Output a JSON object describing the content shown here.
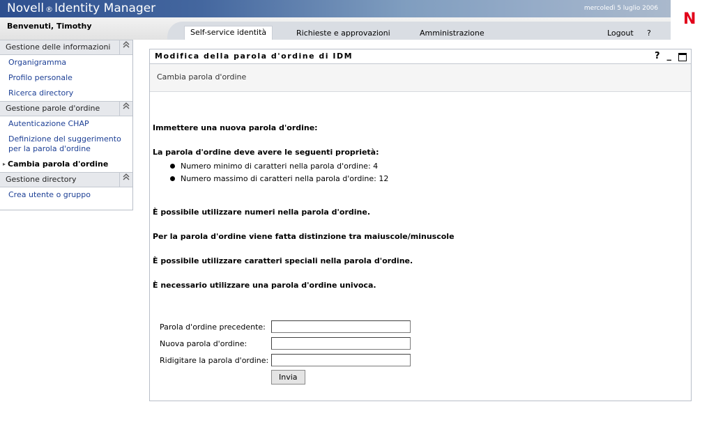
{
  "header": {
    "brand_name": "Novell",
    "brand_reg": "®",
    "brand_product": "Identity Manager",
    "date": "mercoledì 5 luglio 2006",
    "user": "Benvenuti, Timothy",
    "logo_letter": "N"
  },
  "tabs": [
    {
      "label": "Self-service identità",
      "active": true
    },
    {
      "label": "Richieste e approvazioni",
      "active": false
    },
    {
      "label": "Amministrazione",
      "active": false
    },
    {
      "label": "Logout",
      "active": false
    },
    {
      "label": "?",
      "active": false
    }
  ],
  "sidebar": {
    "sections": [
      {
        "title": "Gestione delle informazioni",
        "items": [
          "Organigramma",
          "Profilo personale",
          "Ricerca directory"
        ]
      },
      {
        "title": "Gestione parole d'ordine",
        "items": [
          "Autenticazione CHAP",
          "Definizione del suggerimento per la parola d'ordine",
          "Cambia parola d'ordine"
        ]
      },
      {
        "title": "Gestione directory",
        "items": [
          "Crea utente o gruppo"
        ]
      }
    ],
    "collapse_glyph": "⌃"
  },
  "panel": {
    "title": "Modifica della parola d'ordine di IDM",
    "help": "?",
    "minimize": "_",
    "subtitle": "Cambia parola d'ordine"
  },
  "content": {
    "prompt": "Immettere una nuova parola d'ordine:",
    "rules_heading": "La parola d'ordine deve avere le seguenti proprietà:",
    "rules": [
      "Numero minimo di caratteri nella parola d'ordine: 4",
      "Numero massimo di caratteri nella parola d'ordine: 12"
    ],
    "note_numbers": "È possibile utilizzare numeri nella parola d'ordine.",
    "note_case": "Per la parola d'ordine viene fatta distinzione tra maiuscole/minuscole",
    "note_special": "È possibile utilizzare caratteri speciali nella parola d'ordine.",
    "note_unique": "È necessario utilizzare una parola d'ordine univoca."
  },
  "form": {
    "old_label": "Parola d'ordine precedente:",
    "old_value": "",
    "new_label": "Nuova parola d'ordine:",
    "new_value": "",
    "confirm_label": "Ridigitare la parola d'ordine:",
    "confirm_value": "",
    "submit": "Invia"
  }
}
